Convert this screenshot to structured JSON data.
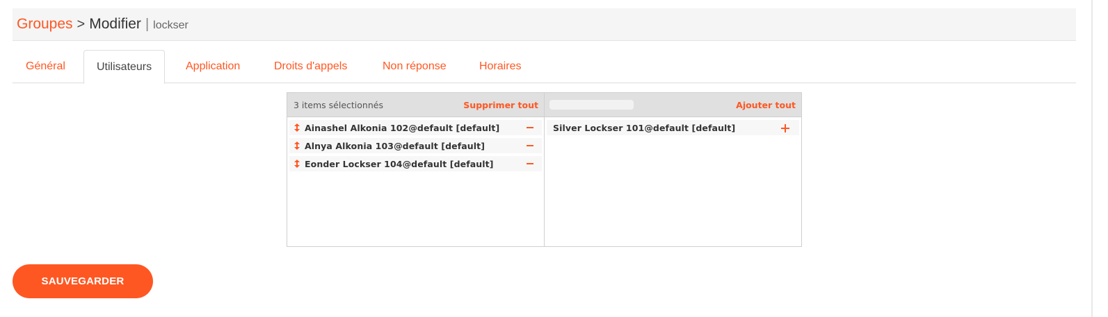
{
  "breadcrumb": {
    "root": "Groupes",
    "separator": ">",
    "current": "Modifier",
    "divider": "|",
    "subject": "lockser"
  },
  "tabs": [
    {
      "label": "Général"
    },
    {
      "label": "Utilisateurs",
      "active": true
    },
    {
      "label": "Application"
    },
    {
      "label": "Droits d'appels"
    },
    {
      "label": "Non réponse"
    },
    {
      "label": "Horaires"
    }
  ],
  "selected_pane": {
    "count_text": "3 items sélectionnés",
    "action_label": "Supprimer tout",
    "items": [
      {
        "label": "Ainashel Alkonia 102@default [default]"
      },
      {
        "label": "Alnya Alkonia 103@default [default]"
      },
      {
        "label": "Eonder Lockser 104@default [default]"
      }
    ]
  },
  "available_pane": {
    "search_value": "",
    "action_label": "Ajouter tout",
    "items": [
      {
        "label": "Silver Lockser 101@default [default]"
      }
    ]
  },
  "save_button": {
    "label": "SAUVEGARDER"
  },
  "colors": {
    "accent": "#ff5722",
    "header_bg": "#f5f5f5",
    "pane_header_bg": "#e0e0e0"
  }
}
